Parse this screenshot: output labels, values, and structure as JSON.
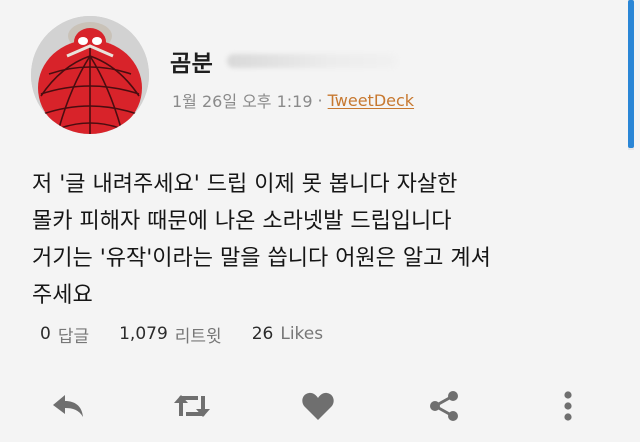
{
  "user": {
    "display_name": "곰분",
    "avatar_icon": "spiderman-balloon-avatar"
  },
  "meta": {
    "date": "1월 26일",
    "time": "오후 1:19",
    "separator": "·",
    "client": "TweetDeck"
  },
  "tweet": {
    "lines": [
      "저 '글 내려주세요' 드립 이제 못 봅니다 자살한",
      "몰카 피해자 때문에 나온 소라넷발 드립입니다",
      "거기는 '유작'이라는 말을 씁니다 어원은 알고 계셔",
      "주세요"
    ]
  },
  "stats": {
    "replies_count": "0",
    "replies_label": "답글",
    "retweets_count": "1,079",
    "retweets_label": "리트윗",
    "likes_count": "26",
    "likes_label": "Likes"
  },
  "actions": {
    "reply_icon": "reply-icon",
    "retweet_icon": "retweet-icon",
    "like_icon": "heart-icon",
    "share_icon": "share-icon",
    "more_icon": "more-vertical-icon"
  },
  "colors": {
    "accent_scroll": "#2a86d6",
    "client_link": "#c7782f",
    "icon_gray": "#6f6f6f",
    "background": "#f4f4f4"
  }
}
